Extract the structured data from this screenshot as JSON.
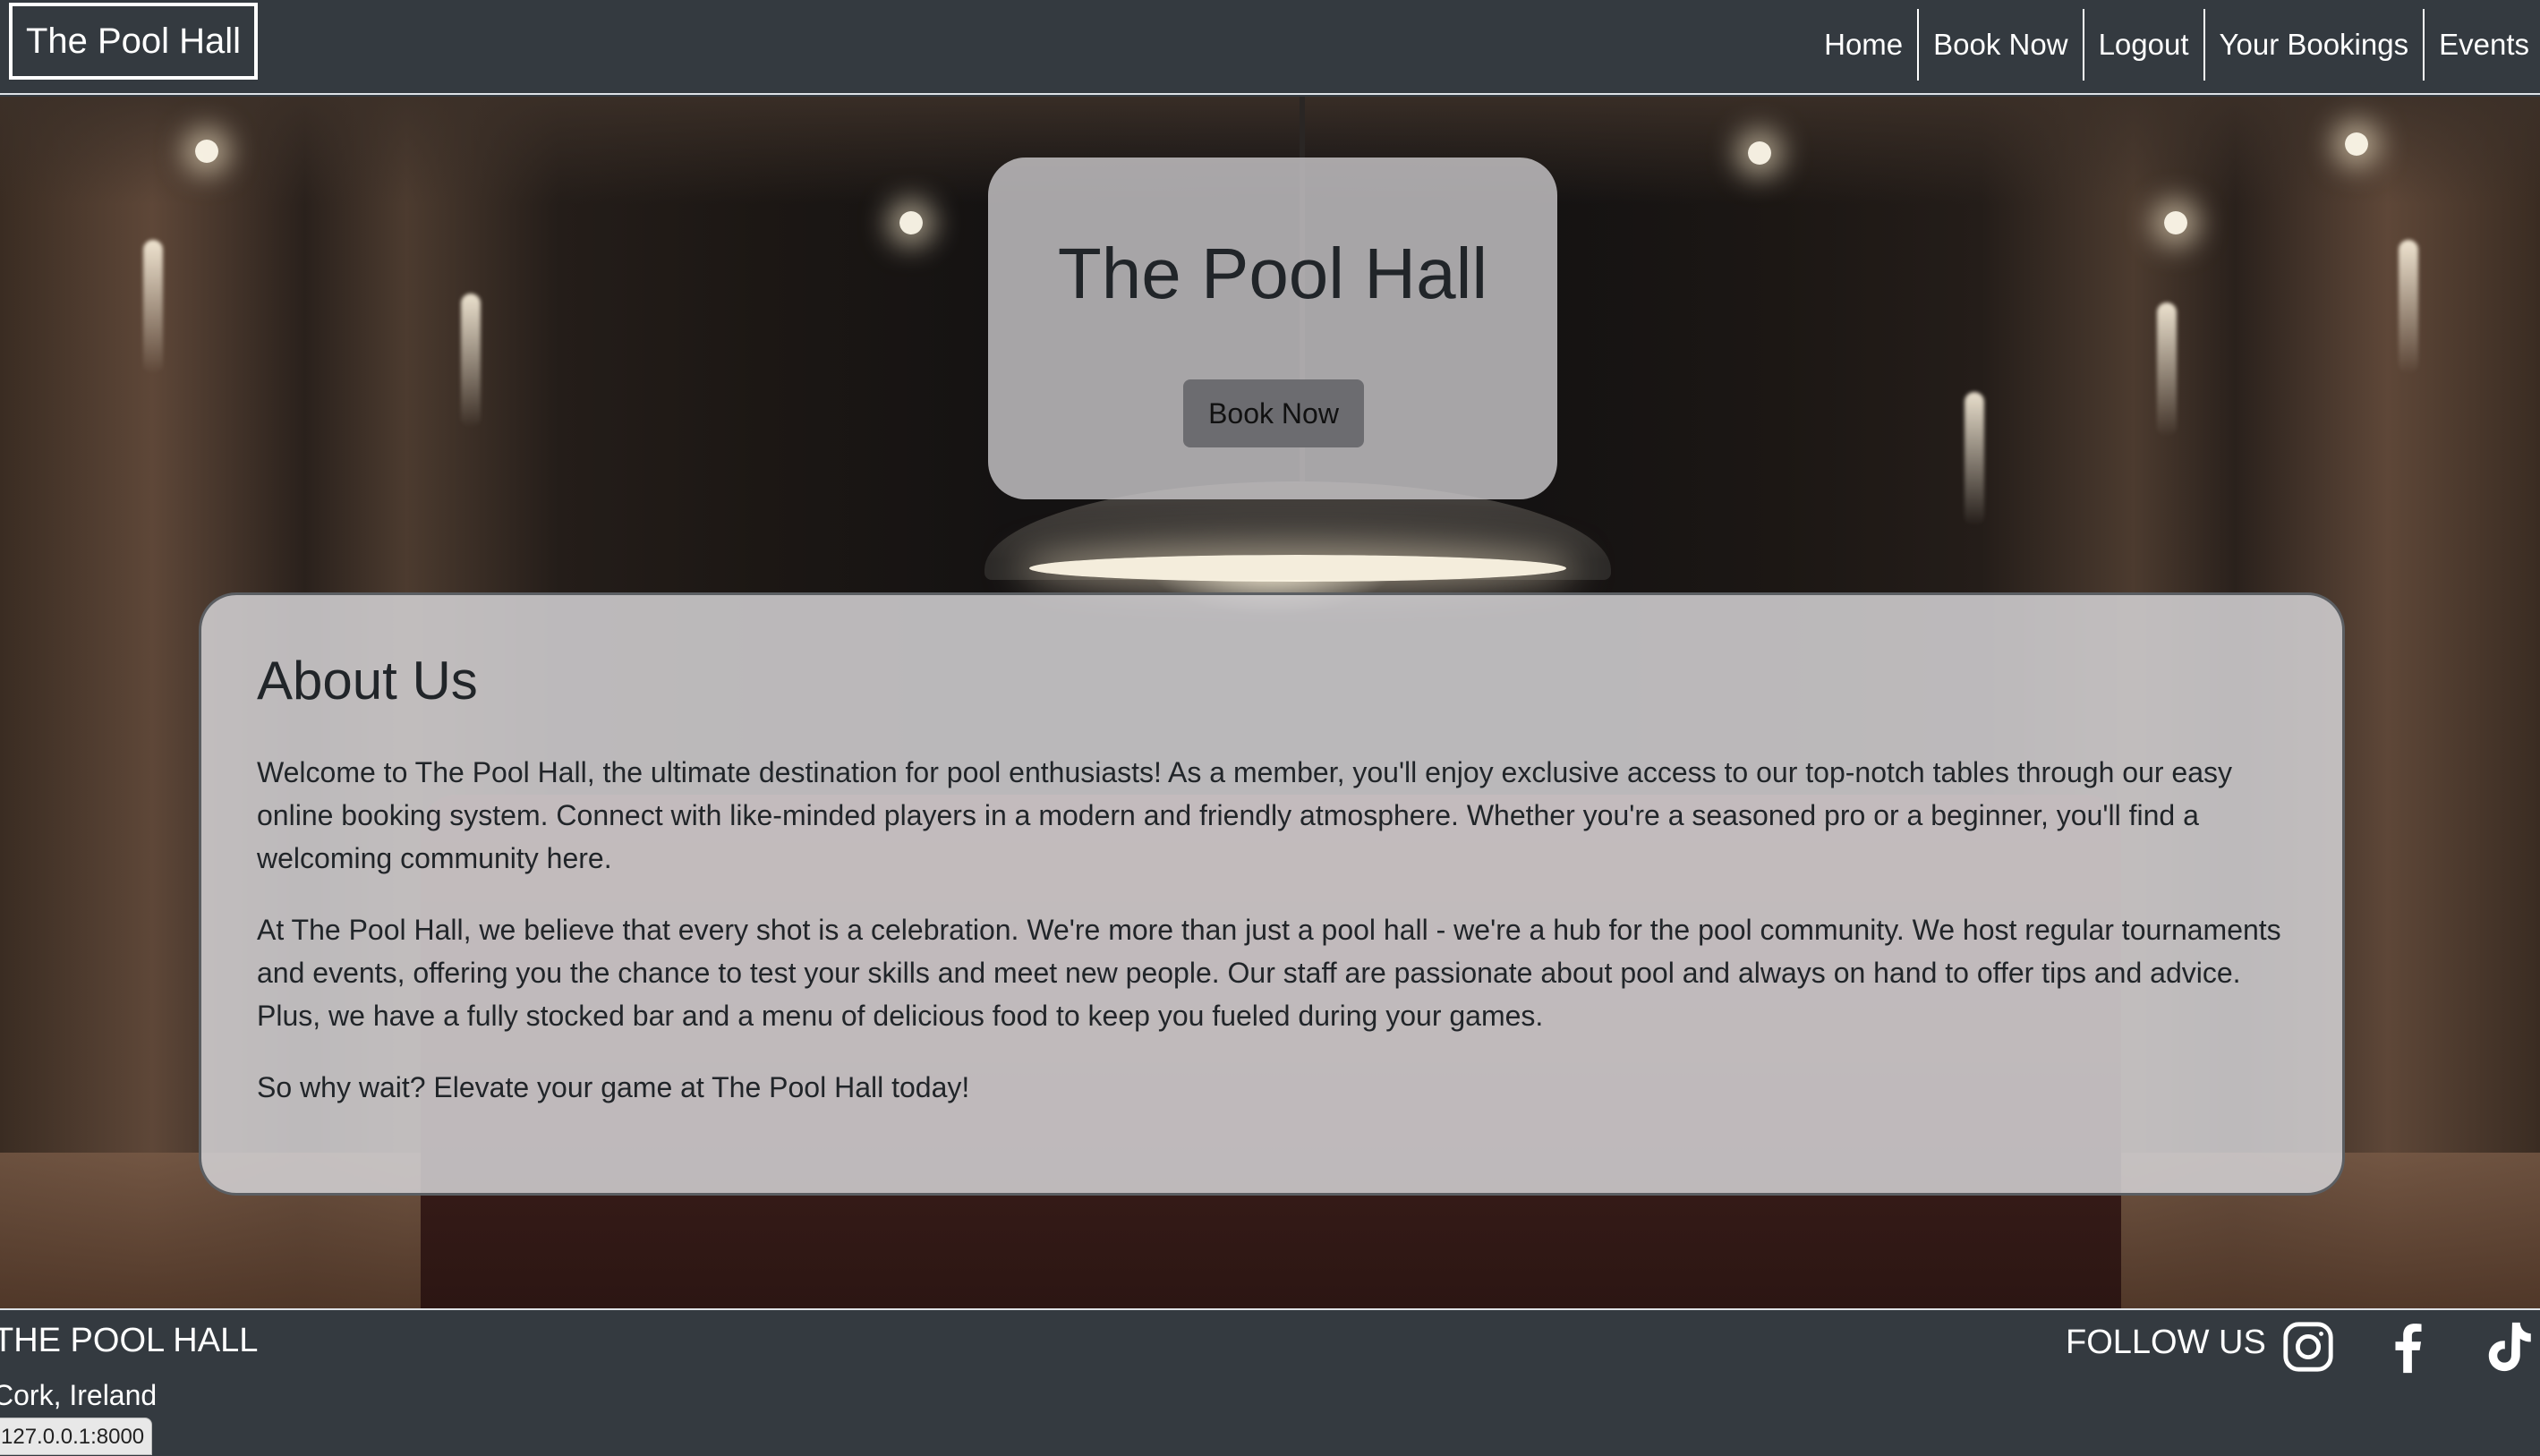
{
  "navbar": {
    "brand": "The Pool Hall",
    "links": [
      "Home",
      "Book Now",
      "Logout",
      "Your Bookings",
      "Events"
    ]
  },
  "hero": {
    "title": "The Pool Hall",
    "button_label": "Book Now"
  },
  "about": {
    "title": "About Us",
    "paragraphs": [
      "Welcome to The Pool Hall, the ultimate destination for pool enthusiasts! As a member, you'll enjoy exclusive access to our top-notch tables through our easy online booking system. Connect with like-minded players in a modern and friendly atmosphere. Whether you're a seasoned pro or a beginner, you'll find a welcoming community here.",
      "At The Pool Hall, we believe that every shot is a celebration. We're more than just a pool hall - we're a hub for the pool community. We host regular tournaments and events, offering you the chance to test your skills and meet new people. Our staff are passionate about pool and always on hand to offer tips and advice. Plus, we have a fully stocked bar and a menu of delicious food to keep you fueled during your games.",
      "So why wait? Elevate your game at The Pool Hall today!"
    ]
  },
  "footer": {
    "name": "THE POOL HALL",
    "location": "Cork, Ireland",
    "follow_label": "FOLLOW US",
    "social_icons": [
      "instagram-icon",
      "facebook-icon",
      "tiktok-icon"
    ]
  },
  "status_bar": {
    "url": "127.0.0.1:8000"
  },
  "colors": {
    "navbar_bg": "#343a40",
    "text_dark": "#212529",
    "card_bg": "#d2cfd2",
    "button_bg": "#6c6c70"
  }
}
